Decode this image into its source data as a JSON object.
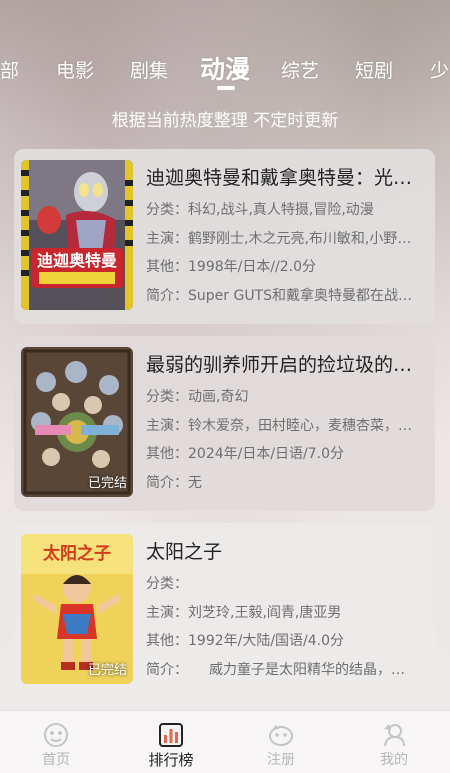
{
  "tabs": [
    "部",
    "电影",
    "剧集",
    "动漫",
    "综艺",
    "短剧",
    "少"
  ],
  "active_tab": "动漫",
  "subtitle": "根据当前热度整理 不定时更新",
  "items": [
    {
      "title": "迪迦奥特曼和戴拿奥特曼：光…",
      "category": "分类：科幻,战斗,真人特摄,冒险,动漫",
      "cast": "主演：鹤野刚士,木之元亮,布川敏和,小野…",
      "other": "其他：1998年/日本//2.0分",
      "summary": "简介：Super GUTS和戴拿奥特曼都在战…",
      "status": "",
      "poster_text": "迪迦奥特曼"
    },
    {
      "title": "最弱的驯养师开启的捡垃圾的…",
      "category": "分类：动画,奇幻",
      "cast": "主演：铃木爱奈，田村睦心，麦穗杏菜，…",
      "other": "其他：2024年/日本/日语/7.0分",
      "summary": "简介：无",
      "status": "已完结",
      "poster_text": ""
    },
    {
      "title": "太阳之子",
      "category": "分类：",
      "cast": "主演：刘芝玲,王毅,阎青,唐亚男",
      "other": "其他：1992年/大陆/国语/4.0分",
      "summary": "简介：　　威力童子是太阳精华的结晶，…",
      "status": "已完结",
      "poster_text": "太阳之子"
    }
  ],
  "nav": [
    {
      "label": "首页",
      "icon": "home-icon"
    },
    {
      "label": "排行榜",
      "icon": "ranking-icon"
    },
    {
      "label": "注册",
      "icon": "register-icon"
    },
    {
      "label": "我的",
      "icon": "profile-icon"
    }
  ],
  "active_nav": "排行榜",
  "colors": {
    "active_text": "#222222",
    "inactive_nav": "#b7b7b7",
    "card_bg": "#e3dfdf"
  }
}
